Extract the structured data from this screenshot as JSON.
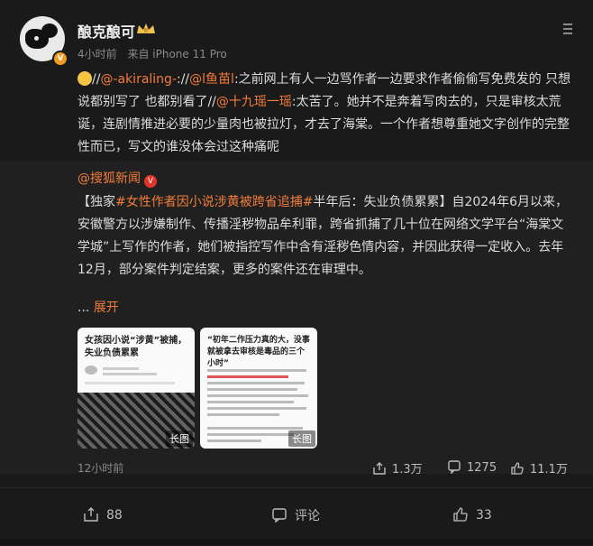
{
  "author": {
    "name": "酿克酿可",
    "level_badge": "II",
    "verified_mark": "V",
    "time": "4小时前",
    "source": "来自 iPhone 11 Pro"
  },
  "post": {
    "emoji": "face-emoji",
    "seg1": "//",
    "mention1": "@-akiraling-",
    "seg2": ":",
    "seg3": "//",
    "mention2": "@l鱼苗l",
    "seg4": ":之前网上有人一边骂作者一边要求作者偷偷写免费发的 只想说都别写了 也都别看了//",
    "mention3": "@十九瑶一瑶",
    "seg5": ":太苦了。她并不是奔着写肉去的，只是审核太荒诞，连剧情推进必要的少量肉也被拉灯，才去了海棠。一个作者想尊重她文字创作的完整性而已，写文的谁没体会过这种痛呢"
  },
  "repost": {
    "source_name": "@搜狐新闻",
    "verified_mark": "V",
    "bracket_open": "【独家",
    "hashtag": "#女性作者因小说涉黄被跨省追捕#",
    "headline_rest": "半年后：失业负债累累】自2024年6月以来，安徽警方以涉嫌制作、传播淫秽物品牟利罪，跨省抓捕了几十位在网络文学平台“海棠文学城”上写作的作者，她们被指控写作中含有淫秽色情内容，并因此获得一定收入。去年12月，部分案件判定结案，更多的案件还在审理中。",
    "ellipsis": "...",
    "expand": "展开",
    "thumb1_title": "女孩因小说“涉黄”被捕，失业负债累累",
    "thumb2_title": "“初年二作压力真的大，没事就被拿去审核是毒品的三个小时”",
    "tag_long": "长图",
    "time": "12小时前",
    "reposts": "1.3万",
    "comments": "1275",
    "likes": "11.1万"
  },
  "actions": {
    "repost_count": "88",
    "comment_label": "评论",
    "like_count": "33"
  },
  "colors": {
    "link": "#f27c3b",
    "bg": "#1a1a1a",
    "panel": "#202020"
  }
}
